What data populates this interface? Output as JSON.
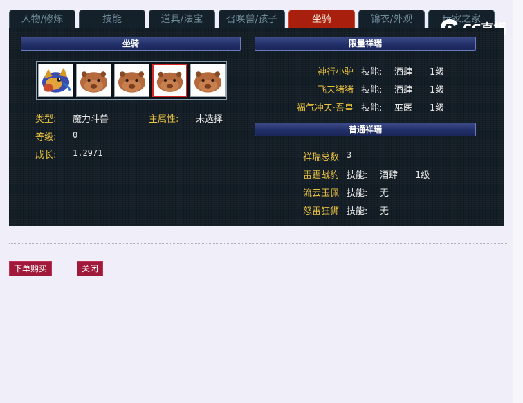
{
  "tabs": [
    {
      "label": "人物/修炼"
    },
    {
      "label": "技能"
    },
    {
      "label": "道具/法宝"
    },
    {
      "label": "召唤兽/孩子"
    },
    {
      "label": "坐骑"
    },
    {
      "label": "锦衣/外观"
    },
    {
      "label": "玩家之家"
    }
  ],
  "active_tab": "坐骑",
  "mount": {
    "header": "坐骑",
    "slots": [
      {
        "icon": "dragon-mount-icon"
      },
      {
        "icon": "capybara-mount-icon"
      },
      {
        "icon": "capybara-mount-icon"
      },
      {
        "icon": "capybara-mount-icon",
        "selected": true
      },
      {
        "icon": "capybara-mount-icon"
      }
    ],
    "type_label": "类型:",
    "type_value": "魔力斗兽",
    "attr_label": "主属性:",
    "attr_value": "未选择",
    "level_label": "等级:",
    "level_value": "0",
    "growth_label": "成长:",
    "growth_value": "1.2971"
  },
  "limited": {
    "header": "限量祥瑞",
    "rows": [
      {
        "name": "神行小驴",
        "skill_label": "技能:",
        "skill": "酒肆",
        "level": "1级"
      },
      {
        "name": "飞天猪猪",
        "skill_label": "技能:",
        "skill": "酒肆",
        "level": "1级"
      },
      {
        "name": "福气冲天·吾皇",
        "skill_label": "技能:",
        "skill": "巫医",
        "level": "1级"
      }
    ]
  },
  "normal": {
    "header": "普通祥瑞",
    "total_label": "祥瑞总数",
    "total_value": "3",
    "rows": [
      {
        "name": "雷霆战豹",
        "skill_label": "技能:",
        "skill": "酒肆",
        "level": "1级"
      },
      {
        "name": "流云玉佩",
        "skill_label": "技能:",
        "skill": "无",
        "level": ""
      },
      {
        "name": "怒雷狂狮",
        "skill_label": "技能:",
        "skill": "无",
        "level": ""
      }
    ]
  },
  "watermark": {
    "text": "CC直播",
    "icon": "cc-logo-icon"
  },
  "buttons": {
    "buy": "下单购买",
    "close": "关闭"
  },
  "colors": {
    "active_tab": "#a81f0e",
    "label_gold": "#e8c040",
    "button": "#a0183a"
  }
}
